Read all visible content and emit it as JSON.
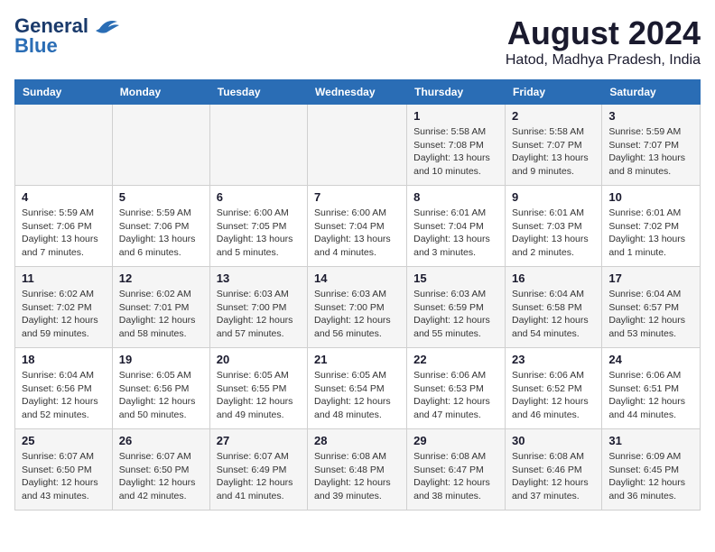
{
  "header": {
    "logo_line1": "General",
    "logo_line2": "Blue",
    "title": "August 2024",
    "subtitle": "Hatod, Madhya Pradesh, India"
  },
  "weekdays": [
    "Sunday",
    "Monday",
    "Tuesday",
    "Wednesday",
    "Thursday",
    "Friday",
    "Saturday"
  ],
  "weeks": [
    [
      {
        "day": "",
        "sunrise": "",
        "sunset": "",
        "daylight": ""
      },
      {
        "day": "",
        "sunrise": "",
        "sunset": "",
        "daylight": ""
      },
      {
        "day": "",
        "sunrise": "",
        "sunset": "",
        "daylight": ""
      },
      {
        "day": "",
        "sunrise": "",
        "sunset": "",
        "daylight": ""
      },
      {
        "day": "1",
        "sunrise": "5:58 AM",
        "sunset": "7:08 PM",
        "daylight": "13 hours and 10 minutes."
      },
      {
        "day": "2",
        "sunrise": "5:58 AM",
        "sunset": "7:07 PM",
        "daylight": "13 hours and 9 minutes."
      },
      {
        "day": "3",
        "sunrise": "5:59 AM",
        "sunset": "7:07 PM",
        "daylight": "13 hours and 8 minutes."
      }
    ],
    [
      {
        "day": "4",
        "sunrise": "5:59 AM",
        "sunset": "7:06 PM",
        "daylight": "13 hours and 7 minutes."
      },
      {
        "day": "5",
        "sunrise": "5:59 AM",
        "sunset": "7:06 PM",
        "daylight": "13 hours and 6 minutes."
      },
      {
        "day": "6",
        "sunrise": "6:00 AM",
        "sunset": "7:05 PM",
        "daylight": "13 hours and 5 minutes."
      },
      {
        "day": "7",
        "sunrise": "6:00 AM",
        "sunset": "7:04 PM",
        "daylight": "13 hours and 4 minutes."
      },
      {
        "day": "8",
        "sunrise": "6:01 AM",
        "sunset": "7:04 PM",
        "daylight": "13 hours and 3 minutes."
      },
      {
        "day": "9",
        "sunrise": "6:01 AM",
        "sunset": "7:03 PM",
        "daylight": "13 hours and 2 minutes."
      },
      {
        "day": "10",
        "sunrise": "6:01 AM",
        "sunset": "7:02 PM",
        "daylight": "13 hours and 1 minute."
      }
    ],
    [
      {
        "day": "11",
        "sunrise": "6:02 AM",
        "sunset": "7:02 PM",
        "daylight": "12 hours and 59 minutes."
      },
      {
        "day": "12",
        "sunrise": "6:02 AM",
        "sunset": "7:01 PM",
        "daylight": "12 hours and 58 minutes."
      },
      {
        "day": "13",
        "sunrise": "6:03 AM",
        "sunset": "7:00 PM",
        "daylight": "12 hours and 57 minutes."
      },
      {
        "day": "14",
        "sunrise": "6:03 AM",
        "sunset": "7:00 PM",
        "daylight": "12 hours and 56 minutes."
      },
      {
        "day": "15",
        "sunrise": "6:03 AM",
        "sunset": "6:59 PM",
        "daylight": "12 hours and 55 minutes."
      },
      {
        "day": "16",
        "sunrise": "6:04 AM",
        "sunset": "6:58 PM",
        "daylight": "12 hours and 54 minutes."
      },
      {
        "day": "17",
        "sunrise": "6:04 AM",
        "sunset": "6:57 PM",
        "daylight": "12 hours and 53 minutes."
      }
    ],
    [
      {
        "day": "18",
        "sunrise": "6:04 AM",
        "sunset": "6:56 PM",
        "daylight": "12 hours and 52 minutes."
      },
      {
        "day": "19",
        "sunrise": "6:05 AM",
        "sunset": "6:56 PM",
        "daylight": "12 hours and 50 minutes."
      },
      {
        "day": "20",
        "sunrise": "6:05 AM",
        "sunset": "6:55 PM",
        "daylight": "12 hours and 49 minutes."
      },
      {
        "day": "21",
        "sunrise": "6:05 AM",
        "sunset": "6:54 PM",
        "daylight": "12 hours and 48 minutes."
      },
      {
        "day": "22",
        "sunrise": "6:06 AM",
        "sunset": "6:53 PM",
        "daylight": "12 hours and 47 minutes."
      },
      {
        "day": "23",
        "sunrise": "6:06 AM",
        "sunset": "6:52 PM",
        "daylight": "12 hours and 46 minutes."
      },
      {
        "day": "24",
        "sunrise": "6:06 AM",
        "sunset": "6:51 PM",
        "daylight": "12 hours and 44 minutes."
      }
    ],
    [
      {
        "day": "25",
        "sunrise": "6:07 AM",
        "sunset": "6:50 PM",
        "daylight": "12 hours and 43 minutes."
      },
      {
        "day": "26",
        "sunrise": "6:07 AM",
        "sunset": "6:50 PM",
        "daylight": "12 hours and 42 minutes."
      },
      {
        "day": "27",
        "sunrise": "6:07 AM",
        "sunset": "6:49 PM",
        "daylight": "12 hours and 41 minutes."
      },
      {
        "day": "28",
        "sunrise": "6:08 AM",
        "sunset": "6:48 PM",
        "daylight": "12 hours and 39 minutes."
      },
      {
        "day": "29",
        "sunrise": "6:08 AM",
        "sunset": "6:47 PM",
        "daylight": "12 hours and 38 minutes."
      },
      {
        "day": "30",
        "sunrise": "6:08 AM",
        "sunset": "6:46 PM",
        "daylight": "12 hours and 37 minutes."
      },
      {
        "day": "31",
        "sunrise": "6:09 AM",
        "sunset": "6:45 PM",
        "daylight": "12 hours and 36 minutes."
      }
    ]
  ],
  "labels": {
    "sunrise_prefix": "Sunrise: ",
    "sunset_prefix": "Sunset: ",
    "daylight_prefix": "Daylight: "
  }
}
